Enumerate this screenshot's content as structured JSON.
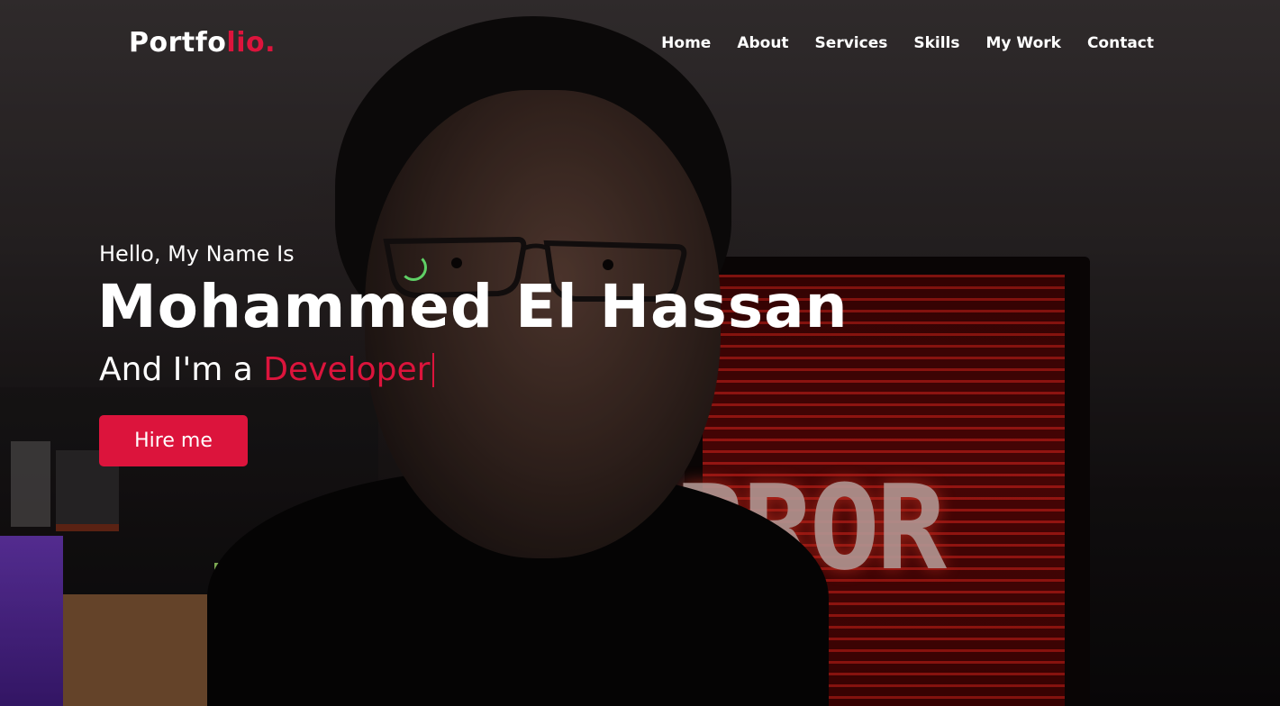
{
  "header": {
    "logo_main": "Portfo",
    "logo_accent": "lio.",
    "nav": [
      "Home",
      "About",
      "Services",
      "Skills",
      "My Work",
      "Contact"
    ]
  },
  "hero": {
    "intro": "Hello, My Name Is",
    "name": "Mohammed El Hassan",
    "role_prefix": "And I'm a ",
    "role_typed": "Developer",
    "cta_label": "Hire me",
    "screen_text": "RROR"
  },
  "colors": {
    "accent": "#dc143c",
    "text": "#ffffff",
    "loader": "#5fd066"
  },
  "icons": {
    "loader": "loading-spinner-icon"
  }
}
